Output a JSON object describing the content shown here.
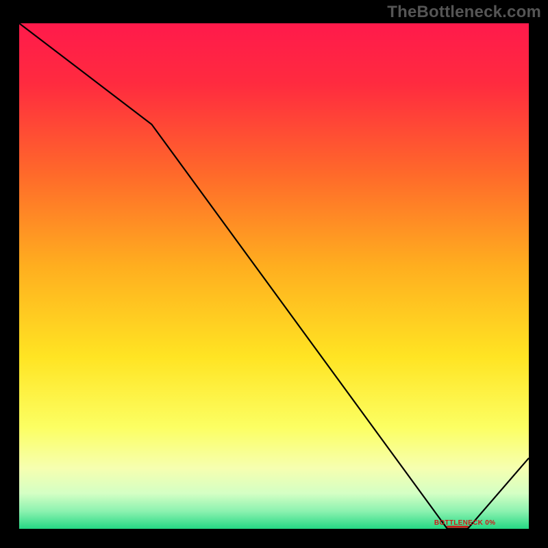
{
  "watermark": "TheBottleneck.com",
  "marker": {
    "label": "BOTTLENECK 0%"
  },
  "chart_data": {
    "type": "line",
    "title": "",
    "xlabel": "",
    "ylabel": "",
    "xlim": [
      0,
      100
    ],
    "ylim": [
      0,
      100
    ],
    "grid": false,
    "legend": false,
    "x": [
      0,
      26,
      84,
      88,
      100
    ],
    "values": [
      100,
      80,
      0,
      0,
      14
    ],
    "gradient_stops": [
      {
        "pos": 0.0,
        "color": "#ff1a4b"
      },
      {
        "pos": 0.12,
        "color": "#ff2b3f"
      },
      {
        "pos": 0.3,
        "color": "#ff6a2a"
      },
      {
        "pos": 0.48,
        "color": "#ffae1f"
      },
      {
        "pos": 0.66,
        "color": "#ffe423"
      },
      {
        "pos": 0.8,
        "color": "#fcff63"
      },
      {
        "pos": 0.88,
        "color": "#f6ffb0"
      },
      {
        "pos": 0.93,
        "color": "#d4ffc4"
      },
      {
        "pos": 0.965,
        "color": "#8cf2b0"
      },
      {
        "pos": 1.0,
        "color": "#25d884"
      }
    ],
    "minimum_band": {
      "x_start": 84,
      "x_end": 88,
      "value": 0
    }
  }
}
